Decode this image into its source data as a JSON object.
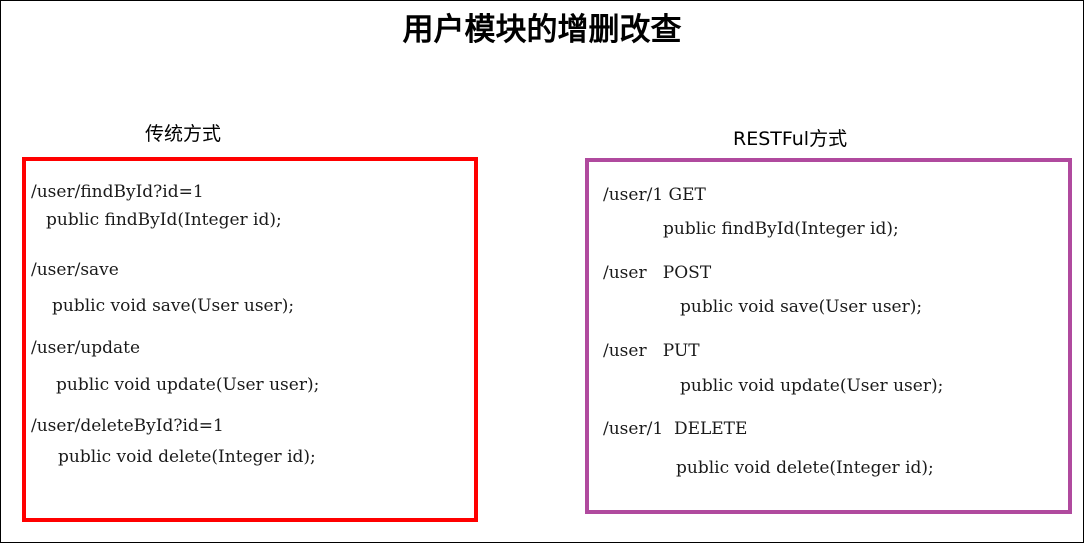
{
  "title": "用户模块的增删改查",
  "traditional": {
    "caption": "传统方式",
    "items": [
      {
        "url": "/user/findById?id=1",
        "method_sig": "public findById(Integer id);"
      },
      {
        "url": "/user/save",
        "method_sig": "public void save(User user);"
      },
      {
        "url": "/user/update",
        "method_sig": "public void update(User user);"
      },
      {
        "url": "/user/deleteById?id=1",
        "method_sig": "public void delete(Integer id);"
      }
    ]
  },
  "restful": {
    "caption": "RESTFul方式",
    "items": [
      {
        "url": "/user/1 GET",
        "method_sig": "public findById(Integer id);"
      },
      {
        "url": "/user   POST",
        "method_sig": "public void save(User user);"
      },
      {
        "url": "/user   PUT",
        "method_sig": "public void update(User user);"
      },
      {
        "url": "/user/1  DELETE",
        "method_sig": "public void delete(Integer id);"
      }
    ]
  },
  "colors": {
    "traditional_border": "#ff0000",
    "restful_border": "#b04a9e",
    "text": "#1a1a1a",
    "background": "#ffffff"
  }
}
